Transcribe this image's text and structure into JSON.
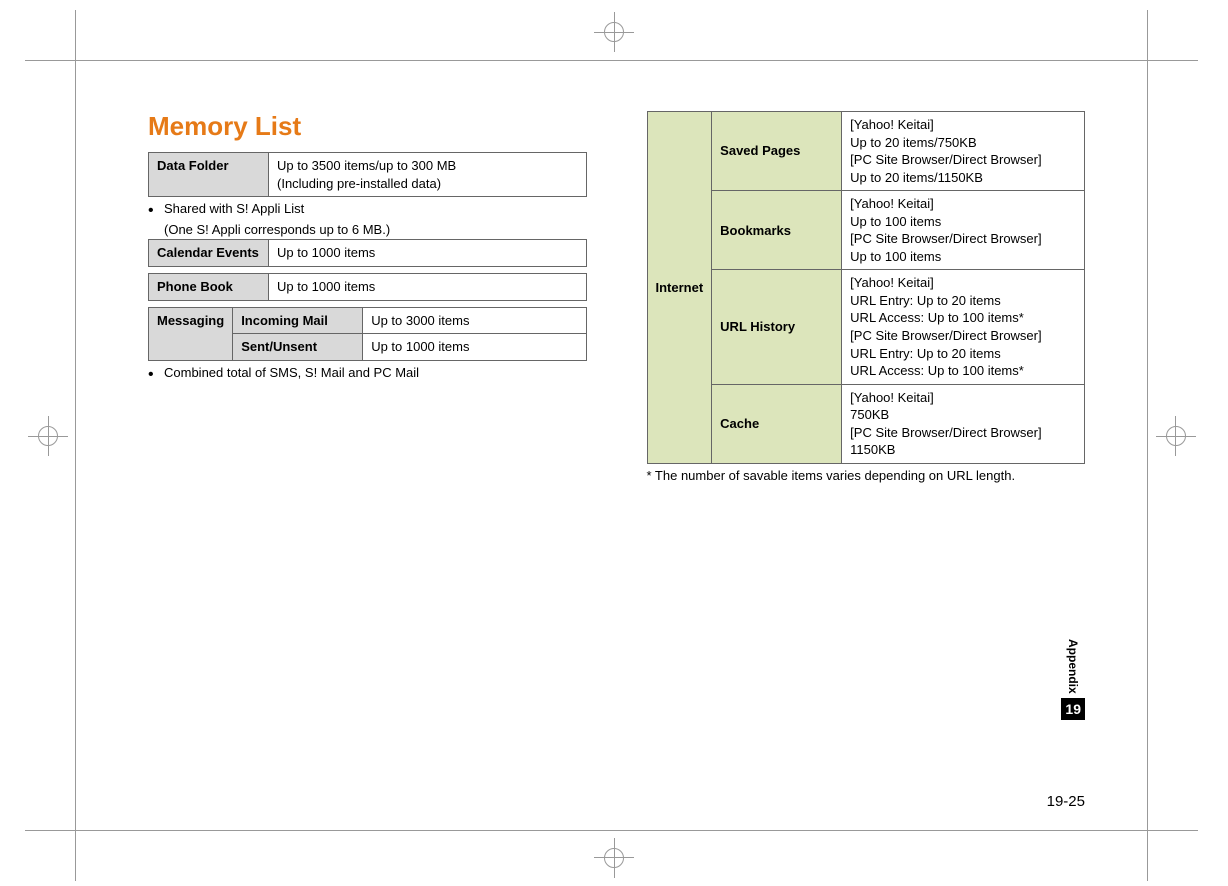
{
  "title": "Memory List",
  "tables": {
    "dataFolder": {
      "label": "Data Folder",
      "value": "Up to 3500 items/up to 300 MB\n(Including pre-installed data)"
    },
    "note1a": "Shared with S! Appli List",
    "note1b": "(One S! Appli corresponds up to 6 MB.)",
    "calendar": {
      "label": "Calendar Events",
      "value": "Up to 1000 items"
    },
    "phonebook": {
      "label": "Phone Book",
      "value": "Up to 1000 items"
    },
    "messaging": {
      "label": "Messaging",
      "rows": [
        {
          "label": "Incoming Mail",
          "value": "Up to 3000 items"
        },
        {
          "label": "Sent/Unsent",
          "value": "Up to 1000 items"
        }
      ]
    },
    "note2": "Combined total of SMS, S! Mail and PC Mail",
    "internet": {
      "label": "Internet",
      "rows": [
        {
          "label": "Saved Pages",
          "value": "[Yahoo! Keitai]\nUp to 20 items/750KB\n[PC Site Browser/Direct Browser]\nUp to 20 items/1150KB"
        },
        {
          "label": "Bookmarks",
          "value": "[Yahoo! Keitai]\nUp to 100 items\n[PC Site Browser/Direct Browser]\nUp to 100 items"
        },
        {
          "label": "URL History",
          "value": "[Yahoo! Keitai]\nURL Entry: Up to 20 items\nURL Access: Up to 100 items*\n[PC Site Browser/Direct Browser]\nURL Entry: Up to 20 items\nURL Access: Up to 100 items*"
        },
        {
          "label": "Cache",
          "value": "[Yahoo! Keitai]\n750KB\n[PC Site Browser/Direct Browser]\n1150KB"
        }
      ]
    },
    "footnote": "* The number of savable items varies depending on URL length."
  },
  "side": {
    "label": "Appendix",
    "chapter": "19"
  },
  "pageNumber": "19-25"
}
